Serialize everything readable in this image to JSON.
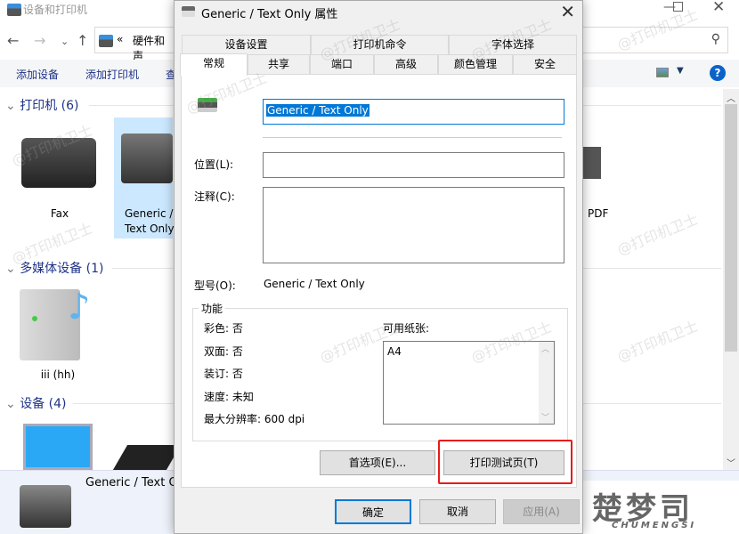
{
  "explorer": {
    "title": "设备和打印机",
    "address": "硬件和声",
    "address_prefix": "«",
    "toolbar": [
      "添加设备",
      "添加打印机",
      "查"
    ],
    "sections": [
      {
        "title": "打印机 (6)",
        "devices": [
          "Fax",
          "Generic / Text Only",
          "PDF"
        ]
      },
      {
        "title": "多媒体设备 (1)",
        "devices": [
          "iii (hh)"
        ]
      },
      {
        "title": "设备 (4)",
        "devices": []
      }
    ],
    "details_name": "Generic / Text O",
    "watermark": "@打印机卫士",
    "logo_text": "楚梦司",
    "logo_sub": "CHUMENGSI"
  },
  "dialog": {
    "title": "Generic / Text Only 属性",
    "tabs_row1": [
      "设备设置",
      "打印机命令",
      "字体选择"
    ],
    "tabs_row2": [
      "常规",
      "共享",
      "端口",
      "高级",
      "颜色管理",
      "安全"
    ],
    "active_tab": "常规",
    "name_value": "Generic / Text Only",
    "location_label": "位置(L):",
    "location_value": "",
    "comment_label": "注释(C):",
    "comment_value": "",
    "model_label": "型号(O):",
    "model_value": "Generic / Text Only",
    "features_title": "功能",
    "features": [
      "彩色: 否",
      "双面: 否",
      "装订: 否",
      "速度: 未知",
      "最大分辨率: 600 dpi"
    ],
    "paper_label": "可用纸张:",
    "papers": [
      "A4"
    ],
    "preferences_button": "首选项(E)...",
    "print_test_button": "打印测试页(T)",
    "ok_button": "确定",
    "cancel_button": "取消",
    "apply_button": "应用(A)",
    "highlight_color": "#e81b1b",
    "accent_color": "#0078d7"
  }
}
